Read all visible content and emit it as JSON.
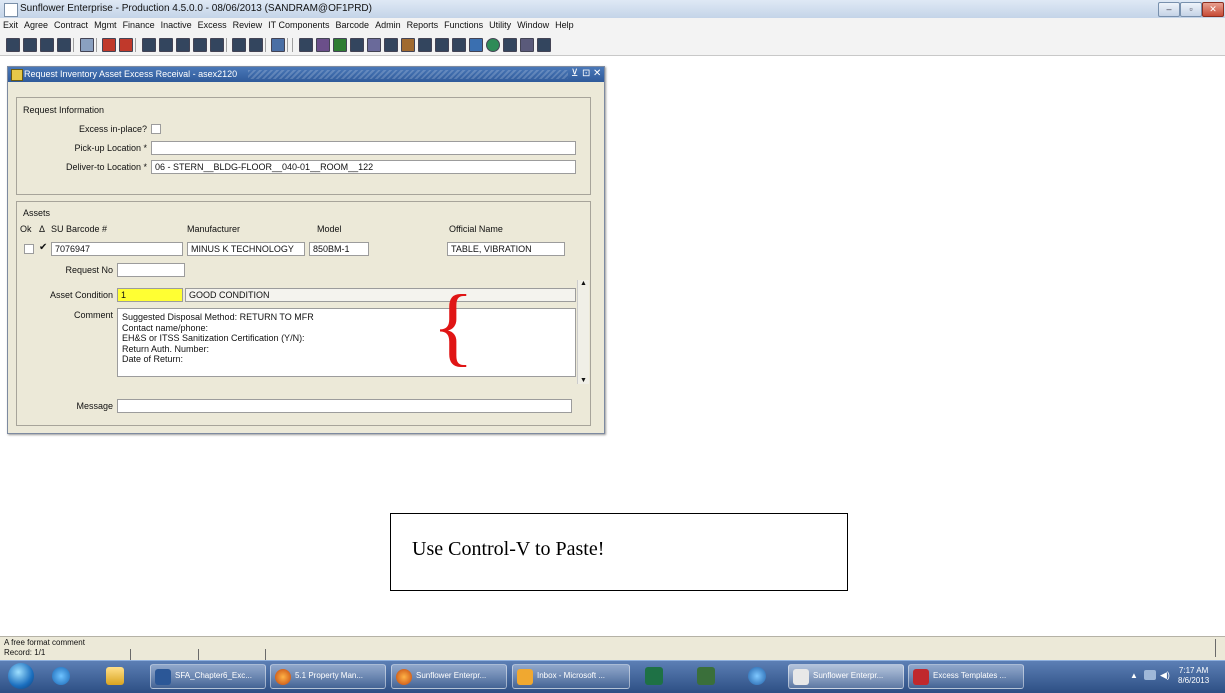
{
  "app": {
    "title": "Sunflower Enterprise - Production 4.5.0.0 - 08/06/2013 (SANDRAM@OF1PRD)"
  },
  "menu": {
    "items": [
      "Exit",
      "Agree",
      "Contract",
      "Mgmt",
      "Finance",
      "Inactive",
      "Excess",
      "Review",
      "IT Components",
      "Barcode",
      "Admin",
      "Reports",
      "Functions",
      "Utility",
      "Window",
      "Help"
    ]
  },
  "form": {
    "title": "Request Inventory Asset Excess Receival - asex2120",
    "request_info": {
      "header": "Request Information",
      "excess_in_place_label": "Excess in-place?",
      "pickup_label": "Pick-up Location *",
      "pickup_value": "",
      "deliver_label": "Deliver-to Location *",
      "deliver_value": "06 - STERN__BLDG-FLOOR__040-01__ROOM__122"
    },
    "assets": {
      "header": "Assets",
      "col_ok": "Ok",
      "col_delta": "Δ",
      "col_barcode": "SU Barcode #",
      "col_manufacturer": "Manufacturer",
      "col_model": "Model",
      "col_official_name": "Official Name",
      "row": {
        "barcode": "7076947",
        "manufacturer": "MINUS K TECHNOLOGY",
        "model": "850BM-1",
        "official_name": "TABLE, VIBRATION",
        "delta_checked": "✔"
      },
      "request_no_label": "Request No",
      "request_no_value": "",
      "condition_label": "Asset Condition",
      "condition_code": "1",
      "condition_desc": "GOOD CONDITION",
      "comment_label": "Comment",
      "comment_lines": [
        "Suggested Disposal Method: RETURN TO MFR",
        "Contact name/phone:",
        "EH&S or ITSS Sanitization Certification (Y/N):",
        "Return Auth. Number:",
        "Date of Return:"
      ],
      "message_label": "Message",
      "message_value": ""
    }
  },
  "annotation": {
    "brace": "{",
    "callout": "Use Control-V to Paste!"
  },
  "status": {
    "hint": "A free format comment",
    "record": "Record: 1/1"
  },
  "taskbar": {
    "buttons": [
      {
        "label": "SFA_Chapter6_Exc..."
      },
      {
        "label": "5.1 Property Man..."
      },
      {
        "label": "Sunflower Enterpr..."
      },
      {
        "label": "Inbox - Microsoft ..."
      },
      {
        "label": "Sunflower Enterpr..."
      },
      {
        "label": "Excess Templates ..."
      }
    ],
    "time": "7:17 AM",
    "date": "8/6/2013"
  },
  "colors": {
    "title_blue": "#2f5a9a",
    "taskbar_blue": "#2d4f84",
    "brace_red": "#e01515",
    "condition_yellow": "#ffff33"
  }
}
